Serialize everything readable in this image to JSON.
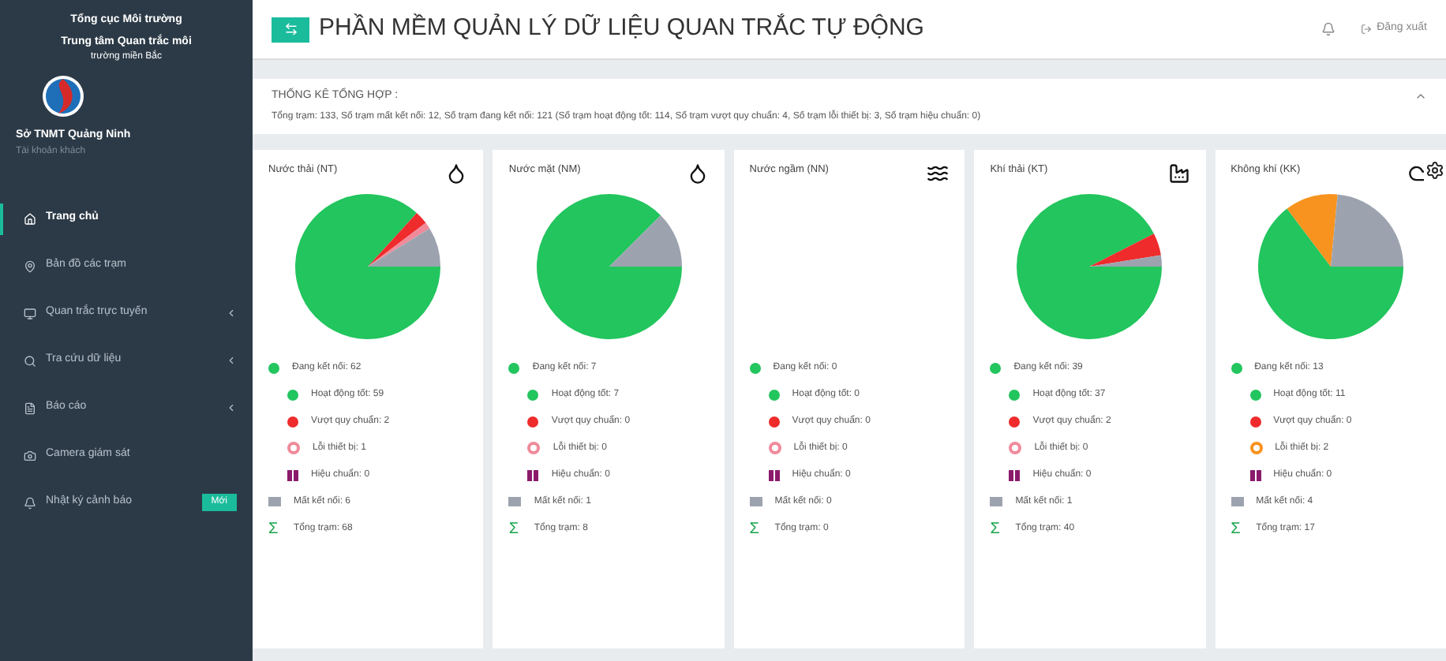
{
  "sidebar": {
    "org": "Tổng cục Môi trường",
    "center": "Trung tâm Quan trắc môi",
    "center_sub": "trường miền Bắc",
    "user": "Sở TNMT Quảng Ninh",
    "role": "Tài khoản khách",
    "items": [
      {
        "label": "Trang chủ",
        "selected": true,
        "kind": "home",
        "expandable": false
      },
      {
        "label": "Bản đồ các trạm",
        "selected": false,
        "kind": "map",
        "expandable": false
      },
      {
        "label": "Quan trắc trực tuyến",
        "selected": false,
        "kind": "monitor",
        "expandable": true
      },
      {
        "label": "Tra cứu dữ liệu",
        "selected": false,
        "kind": "search",
        "expandable": true
      },
      {
        "label": "Báo cáo",
        "selected": false,
        "kind": "report",
        "expandable": true
      },
      {
        "label": "Camera giám sát",
        "selected": false,
        "kind": "camera",
        "expandable": false
      },
      {
        "label": "Nhật ký cảnh báo",
        "selected": false,
        "kind": "alert",
        "expandable": false,
        "badge": "Mới"
      }
    ]
  },
  "header": {
    "title": "PHẦN MỀM QUẢN LÝ DỮ LIỆU QUAN TRẮC TỰ ĐỘNG",
    "logout": "Đăng xuất"
  },
  "summary": {
    "title": "THỐNG KÊ TỔNG HỢP :",
    "text": "Tổng trạm: 133, Số trạm mất kết nối: 12, Số trạm đang kết nối: 121 (Số trạm hoạt động tốt: 114, Số trạm vượt quy chuẩn: 4, Số trạm lỗi thiết bị: 3, Số trạm hiệu chuẩn: 0)",
    "expanded": true
  },
  "cards": [
    {
      "title": "Nước thải (NT)",
      "kind": "wastewater",
      "chart_data": {
        "type": "pie",
        "values": [
          86.77,
          2.94,
          1.47,
          0,
          8.82
        ]
      },
      "legend": [
        {
          "kind": "dot",
          "label": "Đang kết nối: 62",
          "color": "#22c55e",
          "children": [
            {
              "kind": "dot",
              "label": "Hoạt động tốt: 59",
              "color": "#22c55e"
            },
            {
              "kind": "dot",
              "label": "Vượt quy chuẩn: 2",
              "color": "#ef2b2b"
            },
            {
              "kind": "ring",
              "label": "Lỗi thiết bị: 1",
              "color": "#f08a9a"
            },
            {
              "kind": "pause",
              "label": "Hiệu chuẩn: 0",
              "color": "#8b1a6b"
            }
          ]
        },
        {
          "kind": "square",
          "label": "Mất kết nối: 6",
          "color": "#9ca3af"
        },
        {
          "kind": "symbol",
          "symbol": "Σ",
          "label": "Tổng trạm: 68",
          "color": "#16a34a"
        }
      ]
    },
    {
      "title": "Nước mặt (NM)",
      "kind": "surface",
      "chart_data": {
        "type": "pie",
        "values": [
          87.5,
          0,
          0,
          0,
          12.5
        ]
      },
      "legend": [
        {
          "kind": "dot",
          "label": "Đang kết nối: 7",
          "color": "#22c55e",
          "children": [
            {
              "kind": "dot",
              "label": "Hoạt động tốt: 7",
              "color": "#22c55e"
            },
            {
              "kind": "dot",
              "label": "Vượt quy chuẩn: 0",
              "color": "#ef2b2b"
            },
            {
              "kind": "ring",
              "label": "Lỗi thiết bị: 0",
              "color": "#f08a9a"
            },
            {
              "kind": "pause",
              "label": "Hiệu chuẩn: 0",
              "color": "#8b1a6b"
            }
          ]
        },
        {
          "kind": "square",
          "label": "Mất kết nối: 1",
          "color": "#9ca3af"
        },
        {
          "kind": "symbol",
          "symbol": "Σ",
          "label": "Tổng trạm: 8",
          "color": "#16a34a"
        }
      ]
    },
    {
      "title": "Nước ngầm (NN)",
      "kind": "ground",
      "legend": [
        {
          "kind": "dot",
          "label": "Đang kết nối: 0",
          "color": "#22c55e",
          "children": [
            {
              "kind": "dot",
              "label": "Hoạt động tốt: 0",
              "color": "#22c55e"
            },
            {
              "kind": "dot",
              "label": "Vượt quy chuẩn: 0",
              "color": "#ef2b2b"
            },
            {
              "kind": "ring",
              "label": "Lỗi thiết bị: 0",
              "color": "#f08a9a"
            },
            {
              "kind": "pause",
              "label": "Hiệu chuẩn: 0",
              "color": "#8b1a6b"
            }
          ]
        },
        {
          "kind": "square",
          "label": "Mất kết nối: 0",
          "color": "#9ca3af"
        },
        {
          "kind": "symbol",
          "symbol": "Σ",
          "label": "Tổng trạm: 0",
          "color": "#16a34a"
        }
      ]
    },
    {
      "title": "Khí thải (KT)",
      "kind": "emission",
      "chart_data": {
        "type": "pie",
        "values": [
          92.5,
          5,
          0,
          0,
          2.5
        ]
      },
      "legend": [
        {
          "kind": "dot",
          "label": "Đang kết nối: 39",
          "color": "#22c55e",
          "children": [
            {
              "kind": "dot",
              "label": "Hoạt động tốt: 37",
              "color": "#22c55e"
            },
            {
              "kind": "dot",
              "label": "Vượt quy chuẩn: 2",
              "color": "#ef2b2b"
            },
            {
              "kind": "ring",
              "label": "Lỗi thiết bị: 0",
              "color": "#f08a9a"
            },
            {
              "kind": "pause",
              "label": "Hiệu chuẩn: 0",
              "color": "#8b1a6b"
            }
          ]
        },
        {
          "kind": "square",
          "label": "Mất kết nối: 1",
          "color": "#9ca3af"
        },
        {
          "kind": "symbol",
          "symbol": "Σ",
          "label": "Tổng trạm: 40",
          "color": "#16a34a"
        }
      ]
    },
    {
      "title": "Không khí (KK)",
      "kind": "air",
      "chart_data": {
        "type": "pie",
        "values": [
          64.7,
          0,
          11.8,
          0,
          23.5
        ]
      },
      "legend": [
        {
          "kind": "dot",
          "label": "Đang kết nối: 13",
          "color": "#22c55e",
          "children": [
            {
              "kind": "dot",
              "label": "Hoạt động tốt: 11",
              "color": "#22c55e"
            },
            {
              "kind": "dot",
              "label": "Vượt quy chuẩn: 0",
              "color": "#ef2b2b"
            },
            {
              "kind": "ring",
              "label": "Lỗi thiết bị: 2",
              "color": "#f7931e"
            },
            {
              "kind": "pause",
              "label": "Hiệu chuẩn: 0",
              "color": "#8b1a6b"
            }
          ]
        },
        {
          "kind": "square",
          "label": "Mất kết nối: 4",
          "color": "#9ca3af"
        },
        {
          "kind": "symbol",
          "symbol": "Σ",
          "label": "Tổng trạm: 17",
          "color": "#16a34a"
        }
      ]
    }
  ]
}
